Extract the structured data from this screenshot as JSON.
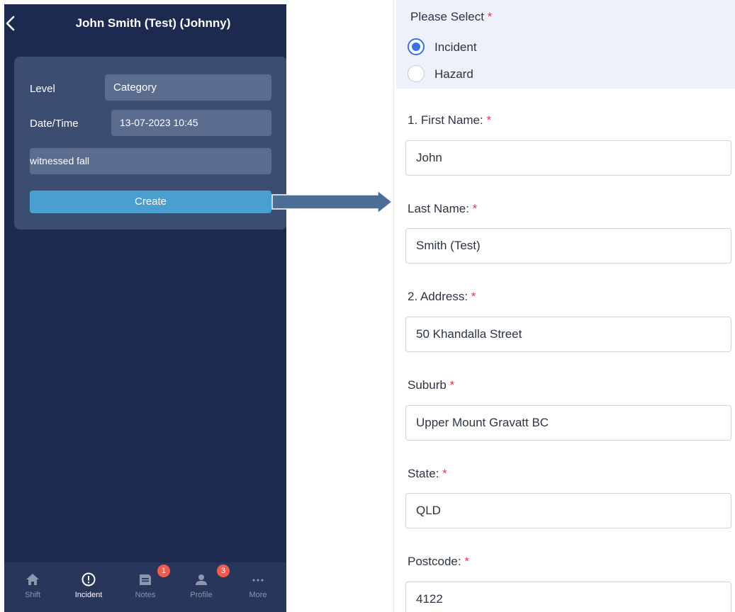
{
  "phone": {
    "title": "John Smith (Test) (Johnny)",
    "card": {
      "level_label": "Level",
      "level_placeholder": "Category",
      "datetime_label": "Date/Time",
      "datetime_value": "13-07-2023 10:45",
      "description_value": "witnessed fall",
      "create_label": "Create"
    },
    "tabs": [
      {
        "label": "Shift",
        "icon": "home-icon"
      },
      {
        "label": "Incident",
        "icon": "alert-circle-icon",
        "active": true
      },
      {
        "label": "Notes",
        "icon": "notes-icon",
        "badge": "1"
      },
      {
        "label": "Profile",
        "icon": "profile-icon",
        "badge": "3"
      },
      {
        "label": "More",
        "icon": "more-icon"
      }
    ]
  },
  "form": {
    "select_title": "Please Select",
    "required_mark": "*",
    "options": [
      {
        "label": "Incident",
        "selected": true
      },
      {
        "label": "Hazard",
        "selected": false
      }
    ],
    "fields": {
      "first_name": {
        "label": "1. First Name:",
        "value": "John"
      },
      "last_name": {
        "label": "Last Name:",
        "value": "Smith (Test)"
      },
      "address": {
        "label": "2. Address:",
        "value": "50 Khandalla Street"
      },
      "suburb": {
        "label": "Suburb",
        "value": "Upper Mount Gravatt BC"
      },
      "state": {
        "label": "State:",
        "value": "QLD"
      },
      "postcode": {
        "label": "Postcode:",
        "value": "4122"
      }
    }
  },
  "colors": {
    "phone_bg": "#1b2a4e",
    "card_bg": "#3b4d70",
    "create_button": "#4a9fd1",
    "badge": "#f05a4f",
    "radio_accent": "#3b6fe6",
    "required": "#e0384b",
    "arrow": "#4a6e96"
  }
}
